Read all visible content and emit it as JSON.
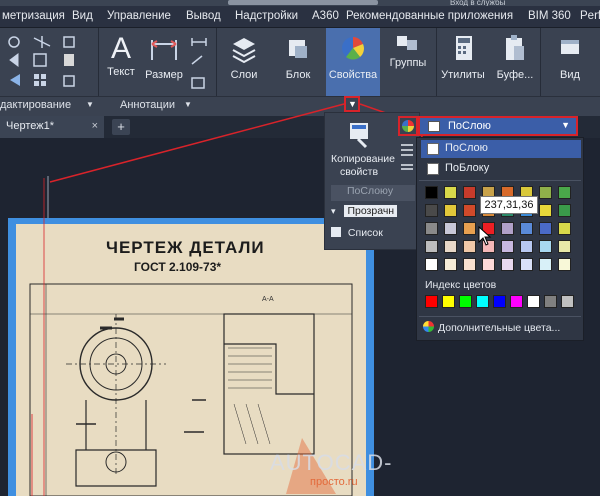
{
  "window": {
    "title_blurred": "",
    "top_right": "Вход в службы"
  },
  "menubar": {
    "items": [
      "метризация",
      "Вид",
      "Управление",
      "Вывод",
      "Надстройки",
      "A360",
      "Рекомендованные приложения",
      "BIM 360",
      "Perfo"
    ]
  },
  "ribbon": {
    "buttons": {
      "text": "Текст",
      "size": "Размер",
      "layers": "Слои",
      "block": "Блок",
      "properties": "Свойства",
      "groups": "Группы",
      "utilities": "Утилиты",
      "buffer": "Буфе...",
      "view": "Вид"
    },
    "footers": {
      "editing": "дактирование",
      "annotations": "Аннотации"
    }
  },
  "tabs": {
    "document": "Чертеж1*",
    "close": "×",
    "add": "+"
  },
  "drawing": {
    "title": "ЧЕРТЕЖ ДЕТАЛИ",
    "subtitle": "ГОСТ 2.109-73*",
    "section_label": "А-А"
  },
  "properties_panel": {
    "copy_props": "Копирование свойств",
    "linetype": "ПоСлоюу",
    "transparency": "Прозрачн",
    "list": "Список"
  },
  "color_combo": {
    "value": "ПоСлою"
  },
  "color_popup": {
    "by_layer": "ПоСлою",
    "by_block": "ПоБлоку",
    "index_label": "Индекс цветов",
    "more_colors": "Дополнительные цвета...",
    "grid_colors": [
      [
        "#000000",
        "#d9d94a",
        "#c83b2b",
        "#c8a24a",
        "#d86a2a",
        "#d9c83a",
        "#8fb04a",
        "#4aa84a"
      ],
      [
        "#4a4a4a",
        "#e2c83a",
        "#d24a2a",
        "#d88a3a",
        "#2a8a6a",
        "#3a8ad8",
        "#e8d83a",
        "#3a9a4a"
      ],
      [
        "#8a8a8a",
        "#c8c8d8",
        "#e8a050",
        "#ed1f24",
        "#b0a0c8",
        "#5a8ad8",
        "#4a6ac8",
        "#d8d84a"
      ],
      [
        "#bdbdbd",
        "#e8d8c8",
        "#f0c8a8",
        "#f5b8b8",
        "#c8b8e0",
        "#b8c8f0",
        "#a8d8f0",
        "#e8e8a8"
      ],
      [
        "#ffffff",
        "#f5ecd8",
        "#f8e0d0",
        "#fcd8d8",
        "#e8d8f0",
        "#d8e0f8",
        "#d8f0f8",
        "#f8f8d8"
      ]
    ],
    "index_colors": [
      "#ff0000",
      "#ffff00",
      "#00ff00",
      "#00ffff",
      "#0000ff",
      "#ff00ff",
      "#ffffff",
      "#808080",
      "#c0c0c0"
    ]
  },
  "tooltip": {
    "value": "237,31,36"
  },
  "watermark": {
    "main": "AUTOCAD-",
    "sub": "просто.ru"
  },
  "colors": {
    "highlight_red": "#d8232a",
    "selection_blue": "#3b5ea8"
  }
}
